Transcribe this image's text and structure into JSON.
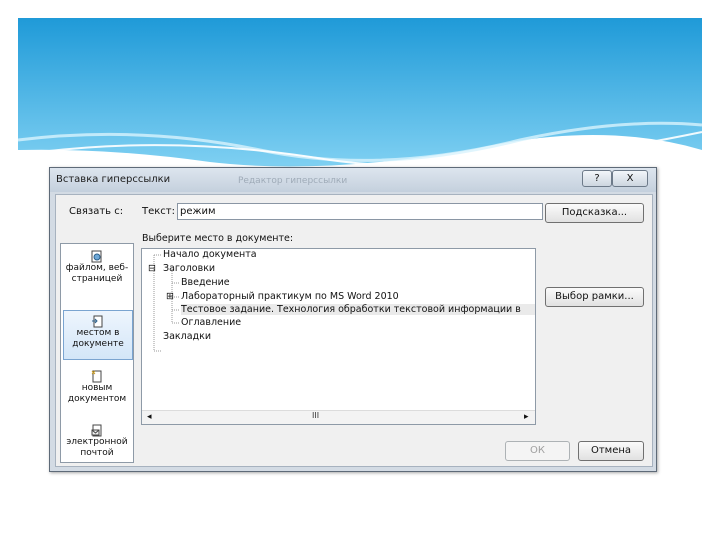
{
  "dialog": {
    "title": "Вставка гиперссылки",
    "ghost_title": "Редактор гиперссылки",
    "help_label": "?",
    "close_label": "X",
    "link_to_label": "Связать с:",
    "text_label": "Текст:",
    "text_value": "режим",
    "tooltip_button": "Подсказка...",
    "select_place_label": "Выберите место в документе:",
    "bookmark_button": "Выбор рамки...",
    "ok_button": "ОК",
    "cancel_button": "Отмена",
    "scroll_grip": "III"
  },
  "link_types": [
    {
      "label_line1": "файлом, веб-",
      "label_line2": "страницей",
      "icon": "globe-file-icon"
    },
    {
      "label_line1": "местом в",
      "label_line2": "документе",
      "icon": "document-place-icon"
    },
    {
      "label_line1": "новым",
      "label_line2": "документом",
      "icon": "new-document-icon"
    },
    {
      "label_line1": "электронной",
      "label_line2": "почтой",
      "icon": "email-icon"
    }
  ],
  "tree": [
    {
      "label": "Начало документа"
    },
    {
      "label": "Заголовки",
      "expander": "⊟"
    },
    {
      "label": "Введение"
    },
    {
      "label": "Лабораторный практикум по MS Word 2010",
      "expander": "⊞"
    },
    {
      "label": "Тестовое задание. Технология обработки текстовой информации в"
    },
    {
      "label": "Оглавление"
    },
    {
      "label": "Закладки"
    }
  ]
}
